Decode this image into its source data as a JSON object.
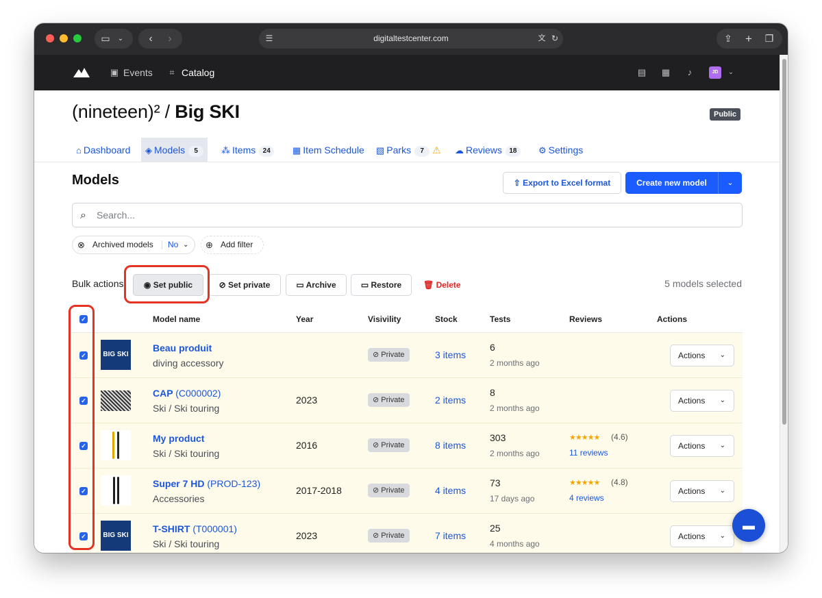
{
  "browser": {
    "url": "digitaltestcenter.com"
  },
  "appnav": {
    "links": [
      {
        "label": "Events"
      },
      {
        "label": "Catalog"
      }
    ],
    "avatar_initials": "JD"
  },
  "header": {
    "title_prefix": "(nineteen)² /",
    "title_main": "Big SKI",
    "badge": "Public"
  },
  "tabs": [
    {
      "label": "Dashboard",
      "count": ""
    },
    {
      "label": "Models",
      "count": "5"
    },
    {
      "label": "Items",
      "count": "24"
    },
    {
      "label": "Item Schedule",
      "count": ""
    },
    {
      "label": "Parks",
      "count": "7"
    },
    {
      "label": "Reviews",
      "count": "18"
    },
    {
      "label": "Settings",
      "count": ""
    }
  ],
  "section": {
    "title": "Models",
    "export_label": "Export to Excel format",
    "create_label": "Create new model"
  },
  "search": {
    "placeholder": "Search..."
  },
  "filters": {
    "archived_label": "Archived models",
    "archived_value": "No",
    "add_filter_label": "Add filter"
  },
  "bulk": {
    "label": "Bulk actions",
    "set_public": "Set public",
    "set_private": "Set private",
    "archive": "Archive",
    "restore": "Restore",
    "delete": "Delete",
    "selected": "5 models selected"
  },
  "table": {
    "columns": [
      "Model name",
      "Year",
      "Visivility",
      "Stock",
      "Tests",
      "Reviews",
      "Actions"
    ],
    "rows": [
      {
        "name": "Beau produit",
        "code": "",
        "category": "diving accessory",
        "year": "",
        "visibility": "Private",
        "stock": "3 items",
        "tests": "6",
        "tests_time": "2 months ago",
        "stars": "",
        "rating": "",
        "reviews": "",
        "actions": "Actions"
      },
      {
        "name": "CAP",
        "code": "(C000002)",
        "category": "Ski / Ski touring",
        "year": "2023",
        "visibility": "Private",
        "stock": "2 items",
        "tests": "8",
        "tests_time": "2 months ago",
        "stars": "",
        "rating": "",
        "reviews": "",
        "actions": "Actions"
      },
      {
        "name": "My product",
        "code": "",
        "category": "Ski / Ski touring",
        "year": "2016",
        "visibility": "Private",
        "stock": "8 items",
        "tests": "303",
        "tests_time": "2 months ago",
        "stars": "★★★★★",
        "rating": "(4.6)",
        "reviews": "11 reviews",
        "actions": "Actions"
      },
      {
        "name": "Super 7 HD",
        "code": "(PROD-123)",
        "category": "Accessories",
        "year": "2017-2018",
        "visibility": "Private",
        "stock": "4 items",
        "tests": "73",
        "tests_time": "17 days ago",
        "stars": "★★★★★",
        "rating": "(4.8)",
        "reviews": "4 reviews",
        "actions": "Actions"
      },
      {
        "name": "T-SHIRT",
        "code": "(T000001)",
        "category": "Ski / Ski touring",
        "year": "2023",
        "visibility": "Private",
        "stock": "7 items",
        "tests": "25",
        "tests_time": "4 months ago",
        "stars": "",
        "rating": "",
        "reviews": "",
        "actions": "Actions"
      }
    ]
  },
  "colors": {
    "accent": "#1a5cff",
    "link": "#1a56db",
    "highlight": "#e53323",
    "row_selected": "#fffbea"
  }
}
